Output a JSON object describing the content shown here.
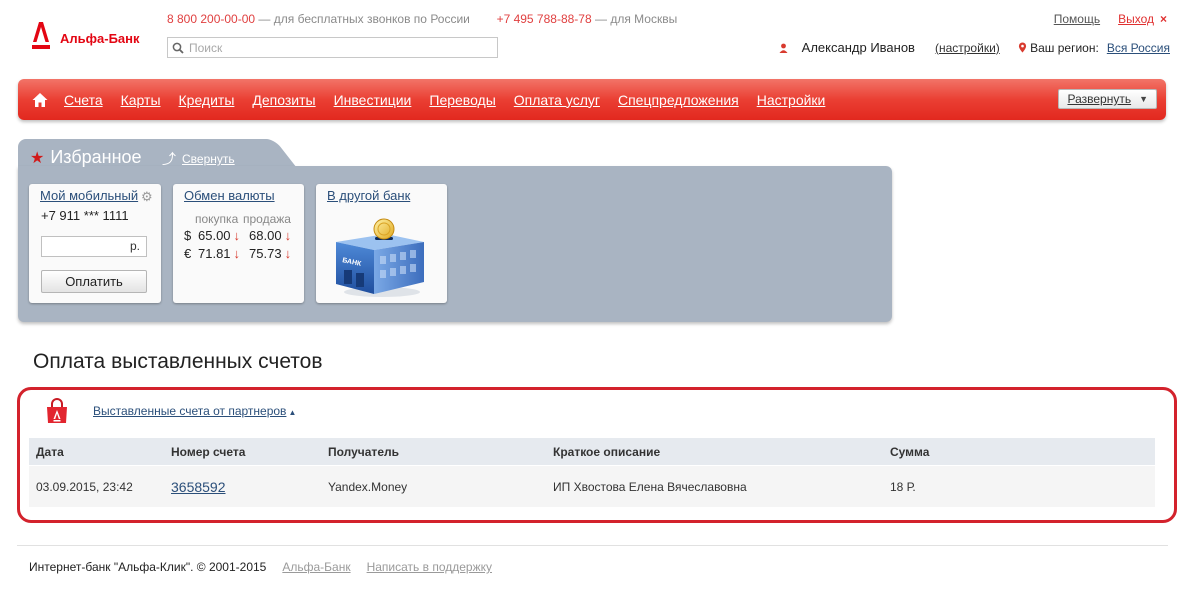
{
  "brand": {
    "name": "Альфа-Банк",
    "color": "#e30613"
  },
  "header": {
    "phone_free": "8 800 200-00-00",
    "phone_free_desc": "— для бесплатных звонков по России",
    "phone_moscow": "+7 495 788-88-78",
    "phone_moscow_desc": "— для Москвы",
    "search_placeholder": "Поиск",
    "help_label": "Помощь",
    "exit_label": "Выход",
    "close_glyph": "×",
    "user_name": "Александр Иванов",
    "settings_label": "(настройки)",
    "region_label": "Ваш регион:",
    "region_value": "Вся Россия"
  },
  "nav": {
    "items": [
      "Счета",
      "Карты",
      "Кредиты",
      "Депозиты",
      "Инвестиции",
      "Переводы",
      "Оплата услуг",
      "Спецпредложения",
      "Настройки"
    ],
    "expand_label": "Развернуть",
    "expand_glyph": "▼"
  },
  "favorites": {
    "title": "Избранное",
    "collapse_label": "Свернуть",
    "mobile": {
      "title": "Мой мобильный",
      "phone": "+7 911 *** 1111",
      "currency": "р.",
      "pay_label": "Оплатить"
    },
    "exchange": {
      "title": "Обмен валюты",
      "buy_label": "покупка",
      "sell_label": "продажа",
      "rates": [
        {
          "symbol": "$",
          "buy": "65.00",
          "sell": "68.00"
        },
        {
          "symbol": "€",
          "buy": "71.81",
          "sell": "75.73"
        }
      ],
      "arrow_glyph": "↓"
    },
    "transfer": {
      "title": "В другой банк",
      "bank_sign": "БАНК"
    }
  },
  "bills": {
    "section_title": "Оплата выставленных счетов",
    "partners_link": "Выставленные счета от партнеров",
    "partners_caret": "▲",
    "columns": [
      "Дата",
      "Номер счета",
      "Получатель",
      "Краткое описание",
      "Сумма"
    ],
    "rows": [
      {
        "date": "03.09.2015, 23:42",
        "number": "3658592",
        "recipient": "Yandex.Money",
        "description": "ИП Хвостова Елена Вячеславовна",
        "amount": "18 Р."
      }
    ]
  },
  "footer": {
    "copyright": "Интернет-банк \"Альфа-Клик\". © 2001-2015",
    "bank_link": "Альфа-Банк",
    "support_link": "Написать в поддержку"
  },
  "icons": [
    "alfa-logo-icon",
    "search-icon",
    "user-icon",
    "location-pin-icon",
    "home-icon",
    "star-icon",
    "collapse-icon",
    "gear-icon",
    "bank-building-icon",
    "shopping-bag-icon"
  ]
}
